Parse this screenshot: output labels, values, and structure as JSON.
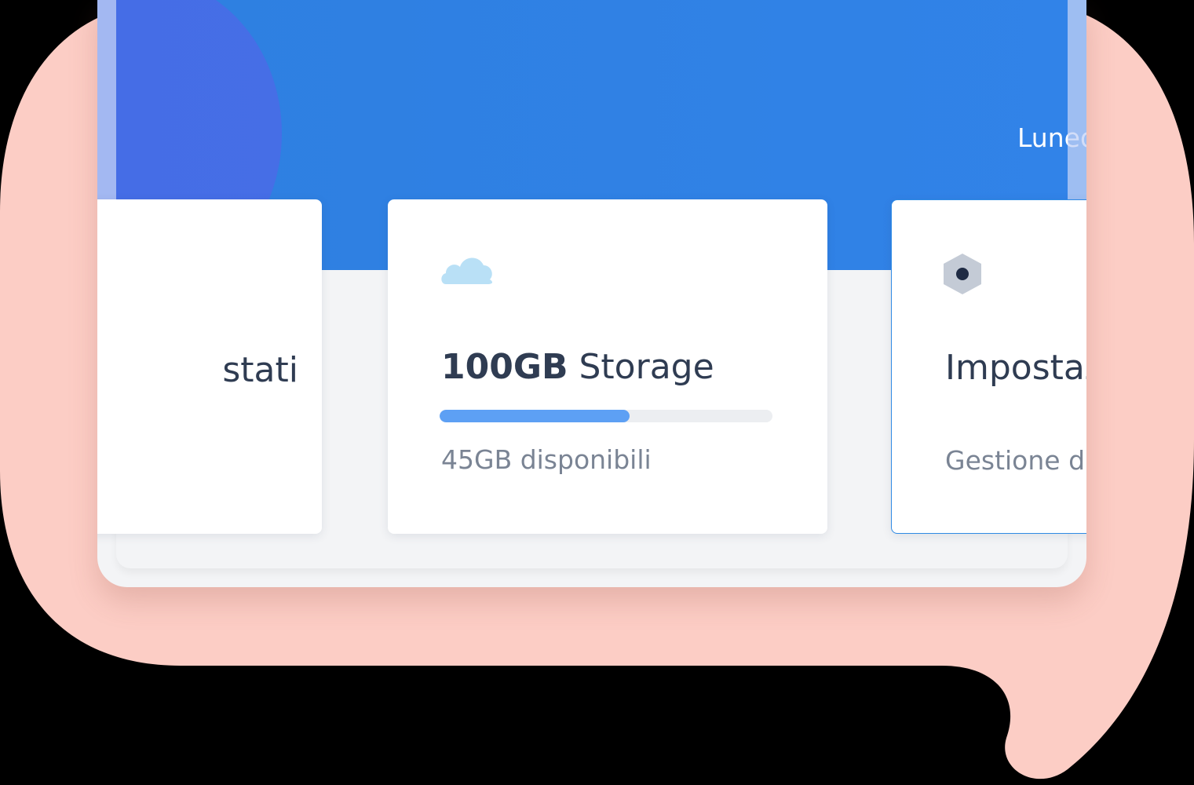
{
  "header": {
    "date_partial": "Luned"
  },
  "cards": {
    "left": {
      "title_partial": "stati"
    },
    "storage": {
      "icon": "cloud-icon",
      "amount": "100GB",
      "label": "Storage",
      "available_text": "45GB disponibili",
      "used_fraction": 0.57
    },
    "settings": {
      "icon": "hexagon-settings-icon",
      "title_partial": "Impostaz",
      "subtitle_partial": "Gestione d"
    }
  },
  "colors": {
    "header_blue": "#3183e8",
    "progress_fill": "#5da0f4",
    "bubble_pink": "#fccdc5",
    "accent_border": "#2f8ae4"
  }
}
